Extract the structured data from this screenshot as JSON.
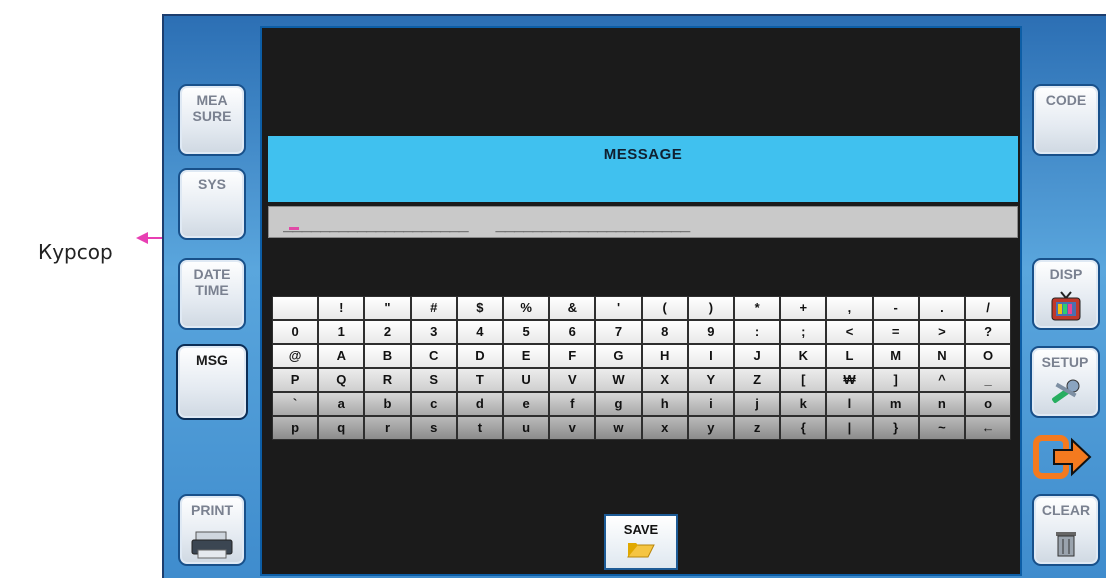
{
  "annotation": {
    "label": "Курсор"
  },
  "left_menu": [
    {
      "label": "MEA\nSURE",
      "icon": ""
    },
    {
      "label": "SYS",
      "icon": ""
    },
    {
      "label": "DATE\nTIME",
      "icon": ""
    },
    {
      "label": "MSG",
      "icon": "",
      "active": true
    },
    {
      "label": "PRINT",
      "icon": "printer-icon"
    }
  ],
  "right_menu": [
    {
      "label": "CODE",
      "icon": ""
    },
    {
      "label": "DISP",
      "icon": "tv-icon"
    },
    {
      "label": "SETUP",
      "icon": "tools-icon"
    },
    {
      "label": "",
      "icon": "exit-icon"
    },
    {
      "label": "CLEAR",
      "icon": "trash-icon"
    }
  ],
  "screen": {
    "title": "MESSAGE",
    "entry_text": "____________________   _____________________"
  },
  "keyboard": {
    "rows": [
      [
        " ",
        "!",
        "\"",
        "#",
        "$",
        "%",
        "&",
        "'",
        "(",
        ")",
        "*",
        "+",
        ",",
        "-",
        ".",
        "/"
      ],
      [
        "0",
        "1",
        "2",
        "3",
        "4",
        "5",
        "6",
        "7",
        "8",
        "9",
        ":",
        ";",
        "<",
        "=",
        ">",
        "?"
      ],
      [
        "@",
        "A",
        "B",
        "C",
        "D",
        "E",
        "F",
        "G",
        "H",
        "I",
        "J",
        "K",
        "L",
        "M",
        "N",
        "O"
      ],
      [
        "P",
        "Q",
        "R",
        "S",
        "T",
        "U",
        "V",
        "W",
        "X",
        "Y",
        "Z",
        "[",
        "₩",
        "]",
        "^",
        "_"
      ],
      [
        "`",
        "a",
        "b",
        "c",
        "d",
        "e",
        "f",
        "g",
        "h",
        "i",
        "j",
        "k",
        "l",
        "m",
        "n",
        "o"
      ],
      [
        "p",
        "q",
        "r",
        "s",
        "t",
        "u",
        "v",
        "w",
        "x",
        "y",
        "z",
        "{",
        "|",
        "}",
        "~",
        "←"
      ]
    ]
  },
  "save_button": {
    "label": "SAVE",
    "icon": "folder-icon"
  },
  "colors": {
    "message_bar": "#40c1ef",
    "cursor": "#e04aa6",
    "accent": "#f47a1f"
  }
}
